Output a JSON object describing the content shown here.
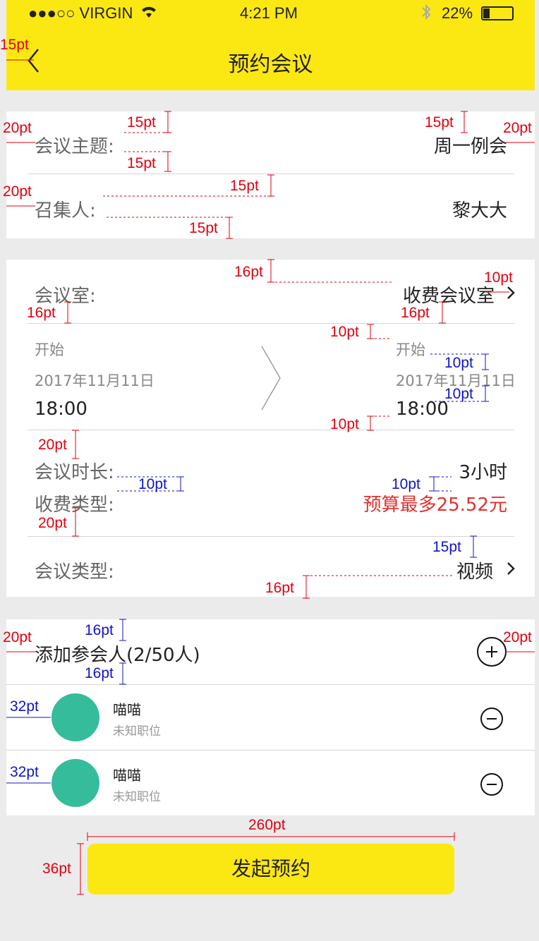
{
  "status_bar": {
    "carrier": "●●●○○ VIRGIN",
    "time": "4:21 PM",
    "battery": "22%"
  },
  "nav": {
    "title": "预约会议"
  },
  "topic": {
    "label": "会议主题:",
    "value": "周一例会"
  },
  "host": {
    "label": "召集人:",
    "value": "黎大大"
  },
  "room": {
    "label": "会议室:",
    "value": "收费会议室"
  },
  "time_block": {
    "start_label": "开始",
    "start_date": "2017年11月11日",
    "start_time": "18:00",
    "end_label": "开始",
    "end_date": "2017年11月11日",
    "end_time": "18:00"
  },
  "duration": {
    "label": "会议时长:",
    "value": "3小时"
  },
  "fee_type": {
    "label": "收费类型:",
    "value": "预算最多25.52元"
  },
  "meeting_type": {
    "label": "会议类型:",
    "value": "视频"
  },
  "participants": {
    "header": "添加参会人(2/50人)",
    "items": [
      {
        "name": "喵喵",
        "position": "未知职位"
      },
      {
        "name": "喵喵",
        "position": "未知职位"
      }
    ]
  },
  "submit_label": "发起预约",
  "annotations": {
    "a_15pt": "15pt",
    "a_20pt": "20pt",
    "a_16pt": "16pt",
    "a_10pt": "10pt",
    "a_32pt": "32pt",
    "a_36pt": "36pt",
    "a_260pt": "260pt"
  },
  "colors": {
    "accent_yellow": "#fbe812",
    "avatar_green": "#35bc9b",
    "price_red": "#e2312f",
    "annotation_red": "#e2000f",
    "annotation_blue": "#1014c8"
  }
}
